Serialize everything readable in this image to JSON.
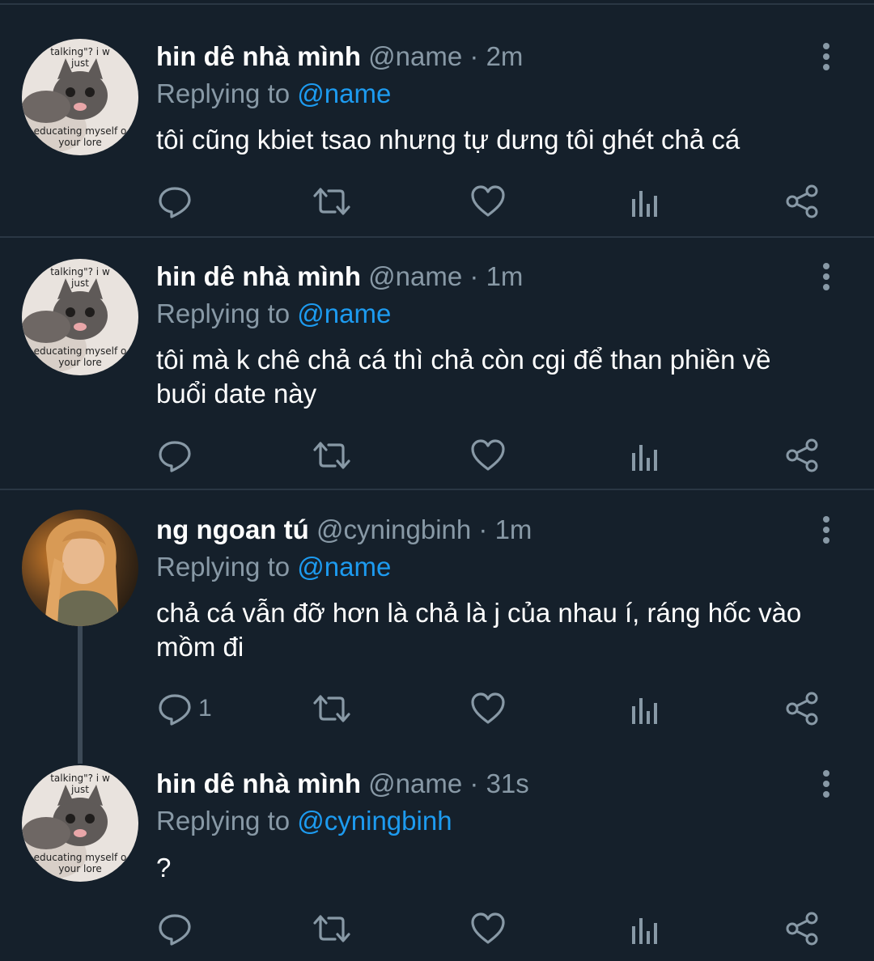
{
  "tweets": [
    {
      "name": "hin dê nhà mình",
      "handle": "@name",
      "time": "2m",
      "reply_prefix": "Replying to ",
      "reply_to": "@name",
      "text": "tôi cũng kbiet tsao nhưng tự dưng tôi ghét chả cá",
      "reply_count": "",
      "avatar": {
        "type": "kitten",
        "caption_top_line1": "talking\"? i w",
        "caption_top_line2": "just",
        "caption_bottom_line1": "educating myself o",
        "caption_bottom_line2": "your lore"
      }
    },
    {
      "name": "hin dê nhà mình",
      "handle": "@name",
      "time": "1m",
      "reply_prefix": "Replying to ",
      "reply_to": "@name",
      "text": "tôi mà k chê chả cá thì chả còn cgi để than phiền về buổi date này",
      "reply_count": "",
      "avatar": {
        "type": "kitten",
        "caption_top_line1": "talking\"? i w",
        "caption_top_line2": "just",
        "caption_bottom_line1": "educating myself o",
        "caption_bottom_line2": "your lore"
      }
    },
    {
      "name": "ng ngoan tú",
      "handle": "@cyningbinh",
      "time": "1m",
      "reply_prefix": "Replying to ",
      "reply_to": "@name",
      "text": "chả cá vẫn đỡ hơn là chả là j của nhau í, ráng hốc vào mồm đi",
      "reply_count": "1",
      "avatar": {
        "type": "photo-person"
      }
    },
    {
      "name": "hin dê nhà mình",
      "handle": "@name",
      "time": "31s",
      "reply_prefix": "Replying to ",
      "reply_to": "@cyningbinh",
      "text": "?",
      "reply_count": "",
      "avatar": {
        "type": "kitten",
        "caption_top_line1": "talking\"? i w",
        "caption_top_line2": "just",
        "caption_bottom_line1": "educating myself o",
        "caption_bottom_line2": "your lore"
      }
    }
  ],
  "separator": " · ",
  "icons": {
    "reply": "reply-icon",
    "retweet": "retweet-icon",
    "like": "heart-icon",
    "analytics": "analytics-icon",
    "share": "share-icon",
    "more": "more-vertical-icon"
  },
  "colors": {
    "background": "#15202b",
    "muted": "#8899a6",
    "link": "#1d9bf0",
    "divider": "#2a3744"
  }
}
